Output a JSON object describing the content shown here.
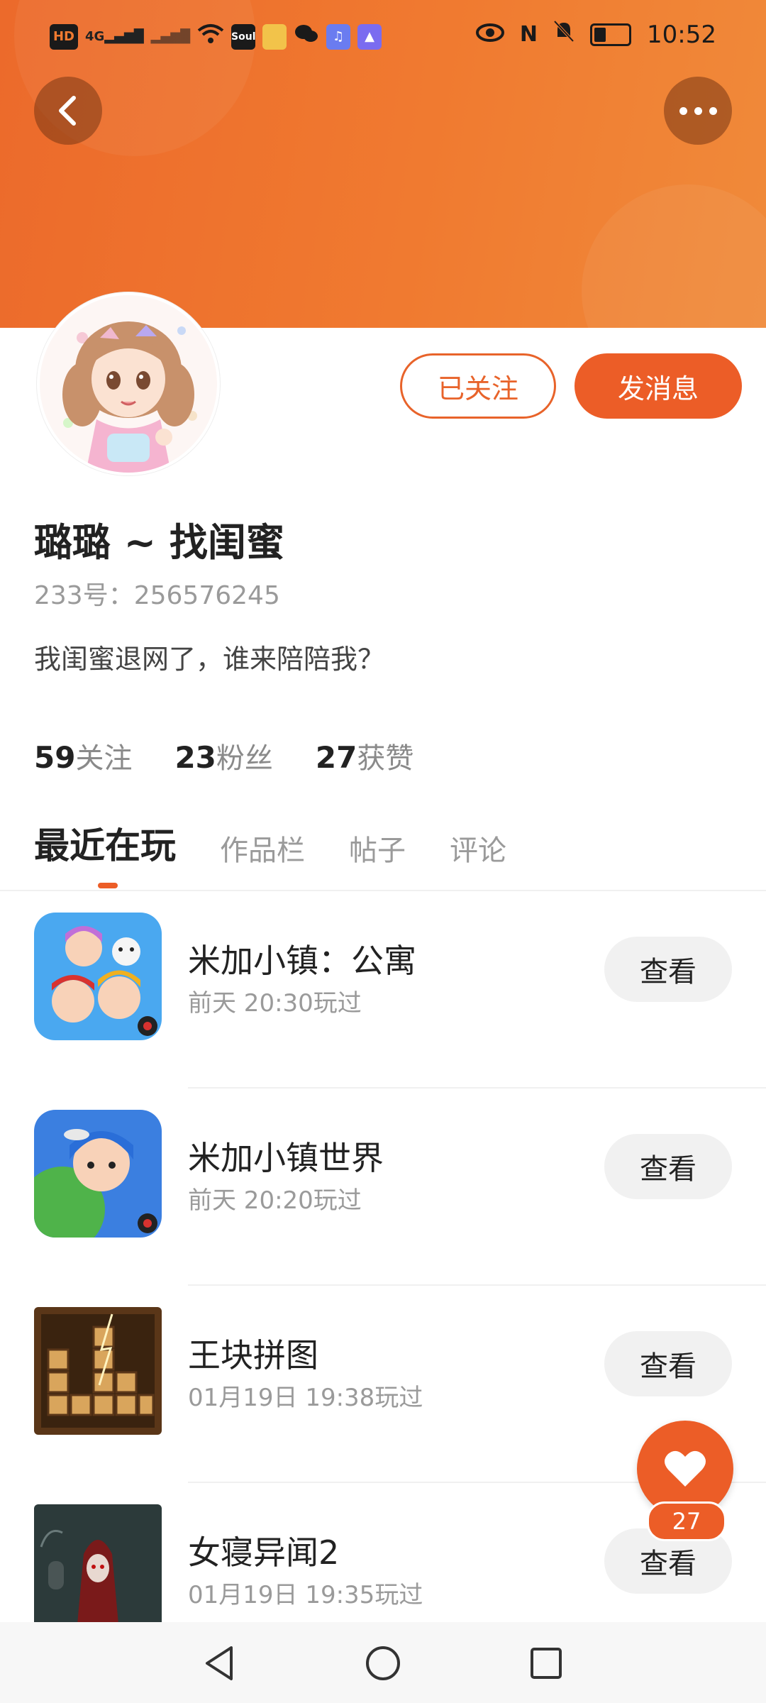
{
  "status_bar": {
    "time": "10:52",
    "left_icons": [
      "hd-icon",
      "signal-4g-icon",
      "signal-icon",
      "wifi-icon",
      "soul-app-icon",
      "app-icon",
      "wechat-icon",
      "music-app-icon",
      "study-app-icon"
    ],
    "right_icons": [
      "eye-icon",
      "nfc-icon",
      "mute-icon",
      "battery-icon"
    ],
    "battery_level": 0.35
  },
  "profile": {
    "name": "璐璐 ~ 找闺蜜",
    "uid": "233号：256576245",
    "bio": "我闺蜜退网了，谁来陪陪我？",
    "followed_label": "已关注",
    "message_label": "发消息"
  },
  "stats": [
    {
      "num": "59",
      "label": "关注"
    },
    {
      "num": "23",
      "label": "粉丝"
    },
    {
      "num": "27",
      "label": "获赞"
    }
  ],
  "tabs": [
    {
      "label": "最近在玩",
      "active": true
    },
    {
      "label": "作品栏",
      "active": false
    },
    {
      "label": "帖子",
      "active": false
    },
    {
      "label": "评论",
      "active": false
    }
  ],
  "games": [
    {
      "name": "米加小镇：公寓",
      "time": "前天 20:30玩过",
      "button": "查看"
    },
    {
      "name": "米加小镇世界",
      "time": "前天 20:20玩过",
      "button": "查看"
    },
    {
      "name": "王块拼图",
      "time": "01月19日 19:38玩过",
      "button": "查看"
    },
    {
      "name": "女寝异闻2",
      "time": "01月19日 19:35玩过",
      "button": "查看"
    }
  ],
  "like_fab": {
    "count": "27"
  },
  "colors": {
    "accent": "#ec5d27",
    "header": "#f07a30"
  }
}
